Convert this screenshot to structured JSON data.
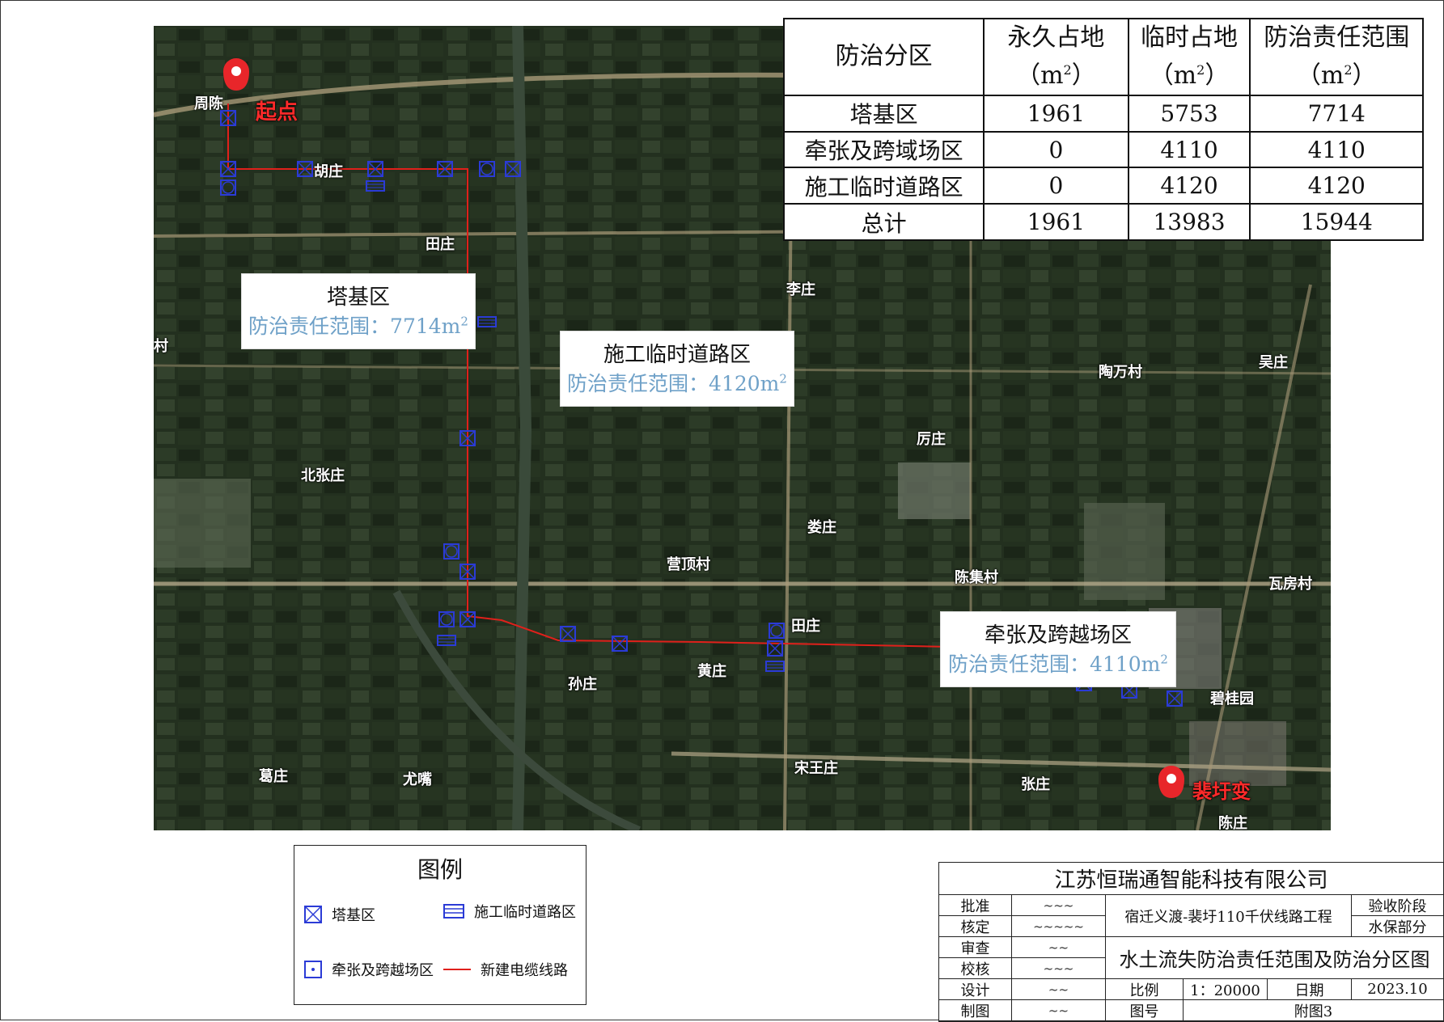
{
  "summary_table": {
    "headers": [
      "防治分区",
      "永久占地",
      "临时占地",
      "防治责任范围"
    ],
    "unit_prefix": "（m",
    "unit_exp": "2",
    "unit_suffix": "）",
    "rows": [
      [
        "塔基区",
        "1961",
        "5753",
        "7714"
      ],
      [
        "牵张及跨域场区",
        "0",
        "4110",
        "4110"
      ],
      [
        "施工临时道路区",
        "0",
        "4120",
        "4120"
      ],
      [
        "总计",
        "1961",
        "13983",
        "15944"
      ]
    ]
  },
  "callouts": {
    "tower": {
      "title": "塔基区",
      "text": "防治责任范围：7714m",
      "exp": "2"
    },
    "road": {
      "title": "施工临时道路区",
      "text": "防治责任范围：4120m",
      "exp": "2"
    },
    "tension": {
      "title": "牵张及跨越场区",
      "text": "防治责任范围：4110m",
      "exp": "2"
    }
  },
  "markers": {
    "start": "起点",
    "end": "裴圩变"
  },
  "places": {
    "zhouchen": "周陈",
    "huzhuang": "胡庄",
    "tianzhuang1": "田庄",
    "lizhuang": "李庄",
    "cun": "村",
    "taowancun": "陶万村",
    "wuzhuang": "吴庄",
    "lizhuang2": "厉庄",
    "beizhangzhuang": "北张庄",
    "louzhuang": "娄庄",
    "yingdingcun": "营顶村",
    "chenjicun": "陈集村",
    "wafangcun": "瓦房村",
    "tianzhuang2": "田庄",
    "huangzhuang": "黄庄",
    "sunzhuang": "孙庄",
    "songwangzhuang": "宋王庄",
    "gezhuang": "葛庄",
    "youzui": "尤嘴",
    "zhangzhuang": "张庄",
    "chenzhuang": "陈庄",
    "biguiyuan": "碧桂园"
  },
  "legend": {
    "title": "图例",
    "tower": "塔基区",
    "road": "施工临时道路区",
    "tension": "牵张及跨越场区",
    "line": "新建电缆线路"
  },
  "title_block": {
    "company": "江苏恒瑞通智能科技有限公司",
    "roles": [
      "批准",
      "核定",
      "审查",
      "校核",
      "设计",
      "制图"
    ],
    "project": "宿迁义渡-裴圩110千伏线路工程",
    "stage_label": "验收阶段",
    "dept": "水保部分",
    "drawing_title": "水土流失防治责任范围及防治分区图",
    "scale_label": "比例",
    "scale_value": "1：20000",
    "date_label": "日期",
    "date_value": "2023.10",
    "figno_label": "图号",
    "figno_value": "附图3"
  },
  "colors": {
    "route": "#e0201b",
    "symbol": "#2b3bd6",
    "callout_text": "#6fa1c8",
    "marker": "#e8262a"
  }
}
